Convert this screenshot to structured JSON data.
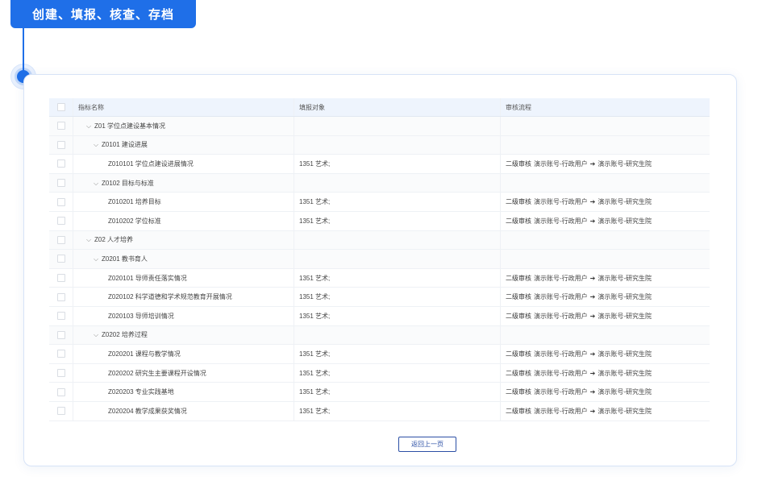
{
  "step_title": "创建、填报、核查、存档",
  "table": {
    "headers": {
      "name": "指标名称",
      "object": "填报对象",
      "flow": "审核流程"
    },
    "rows": [
      {
        "level": 1,
        "name": "Z01 学位点建设基本情况",
        "object": "",
        "flow": null,
        "expandable": true
      },
      {
        "level": 2,
        "name": "Z0101 建设进展",
        "object": "",
        "flow": null,
        "expandable": true
      },
      {
        "level": 3,
        "name": "Z010101 学位点建设进展情况",
        "object": "1351 艺术;",
        "flow": {
          "level": "二级审核",
          "from": "演示账号-行政用户",
          "to": "演示账号-研究生院"
        }
      },
      {
        "level": 2,
        "name": "Z0102 目标与标准",
        "object": "",
        "flow": null,
        "expandable": true
      },
      {
        "level": 3,
        "name": "Z010201 培养目标",
        "object": "1351 艺术;",
        "flow": {
          "level": "二级审核",
          "from": "演示账号-行政用户",
          "to": "演示账号-研究生院"
        }
      },
      {
        "level": 3,
        "name": "Z010202 学位标准",
        "object": "1351 艺术;",
        "flow": {
          "level": "二级审核",
          "from": "演示账号-行政用户",
          "to": "演示账号-研究生院"
        }
      },
      {
        "level": 1,
        "name": "Z02 人才培养",
        "object": "",
        "flow": null,
        "expandable": true
      },
      {
        "level": 2,
        "name": "Z0201 教书育人",
        "object": "",
        "flow": null,
        "expandable": true
      },
      {
        "level": 3,
        "name": "Z020101 导师责任落实情况",
        "object": "1351 艺术;",
        "flow": {
          "level": "二级审核",
          "from": "演示账号-行政用户",
          "to": "演示账号-研究生院"
        }
      },
      {
        "level": 3,
        "name": "Z020102 科学道德和学术规范教育开展情况",
        "object": "1351 艺术;",
        "flow": {
          "level": "二级审核",
          "from": "演示账号-行政用户",
          "to": "演示账号-研究生院"
        }
      },
      {
        "level": 3,
        "name": "Z020103 导师培训情况",
        "object": "1351 艺术;",
        "flow": {
          "level": "二级审核",
          "from": "演示账号-行政用户",
          "to": "演示账号-研究生院"
        }
      },
      {
        "level": 2,
        "name": "Z0202 培养过程",
        "object": "",
        "flow": null,
        "expandable": true
      },
      {
        "level": 3,
        "name": "Z020201 课程与教学情况",
        "object": "1351 艺术;",
        "flow": {
          "level": "二级审核",
          "from": "演示账号-行政用户",
          "to": "演示账号-研究生院"
        }
      },
      {
        "level": 3,
        "name": "Z020202 研究生主要课程开设情况",
        "object": "1351 艺术;",
        "flow": {
          "level": "二级审核",
          "from": "演示账号-行政用户",
          "to": "演示账号-研究生院"
        }
      },
      {
        "level": 3,
        "name": "Z020203 专业实践基地",
        "object": "1351 艺术;",
        "flow": {
          "level": "二级审核",
          "from": "演示账号-行政用户",
          "to": "演示账号-研究生院"
        }
      },
      {
        "level": 3,
        "name": "Z020204 教学成果获奖情况",
        "object": "1351 艺术;",
        "flow": {
          "level": "二级审核",
          "from": "演示账号-行政用户",
          "to": "演示账号-研究生院"
        }
      }
    ]
  },
  "back_button_label": "返回上一页",
  "colors": {
    "accent": "#1f6fe8",
    "button_border": "#2b4fa5",
    "header_bg": "#eef4fd"
  },
  "icons": {
    "expand": "chevron-down-icon",
    "arrow": "arrow-right-icon"
  }
}
